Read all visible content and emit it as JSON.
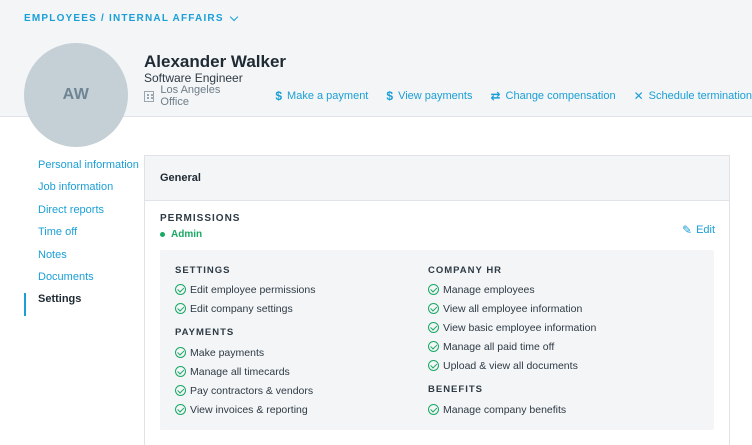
{
  "breadcrumb": {
    "text": "EMPLOYEES / INTERNAL AFFAIRS"
  },
  "employee": {
    "initials": "AW",
    "name": "Alexander Walker",
    "title": "Software Engineer",
    "office": "Los Angeles Office"
  },
  "actions": [
    {
      "icon": "dollar-icon",
      "glyph": "$",
      "label": "Make a payment"
    },
    {
      "icon": "dollar-icon",
      "glyph": "$",
      "label": "View payments"
    },
    {
      "icon": "swap-icon",
      "glyph": "⇄",
      "label": "Change compensation"
    },
    {
      "icon": "close-icon",
      "glyph": "✕",
      "label": "Schedule termination"
    }
  ],
  "nav": {
    "active": "Settings",
    "items": [
      "Personal information",
      "Job information",
      "Direct reports",
      "Time off",
      "Notes",
      "Documents",
      "Settings"
    ]
  },
  "card": {
    "title": "General",
    "permissions_label": "PERMISSIONS",
    "role": "Admin",
    "edit_label": "Edit"
  },
  "groups": {
    "settings": {
      "title": "SETTINGS",
      "items": [
        "Edit employee permissions",
        "Edit company settings"
      ]
    },
    "payments": {
      "title": "PAYMENTS",
      "items": [
        "Make payments",
        "Manage all timecards",
        "Pay contractors & vendors",
        "View invoices & reporting"
      ]
    },
    "company_hr": {
      "title": "COMPANY HR",
      "items": [
        "Manage employees",
        "View all employee information",
        "View basic employee information",
        "Manage all paid time off",
        "Upload & view all documents"
      ]
    },
    "benefits": {
      "title": "BENEFITS",
      "items": [
        "Manage company benefits"
      ]
    }
  },
  "colors": {
    "accent": "#1a9fd6",
    "success": "#1aa865",
    "header_bg": "#f3f5f7"
  }
}
